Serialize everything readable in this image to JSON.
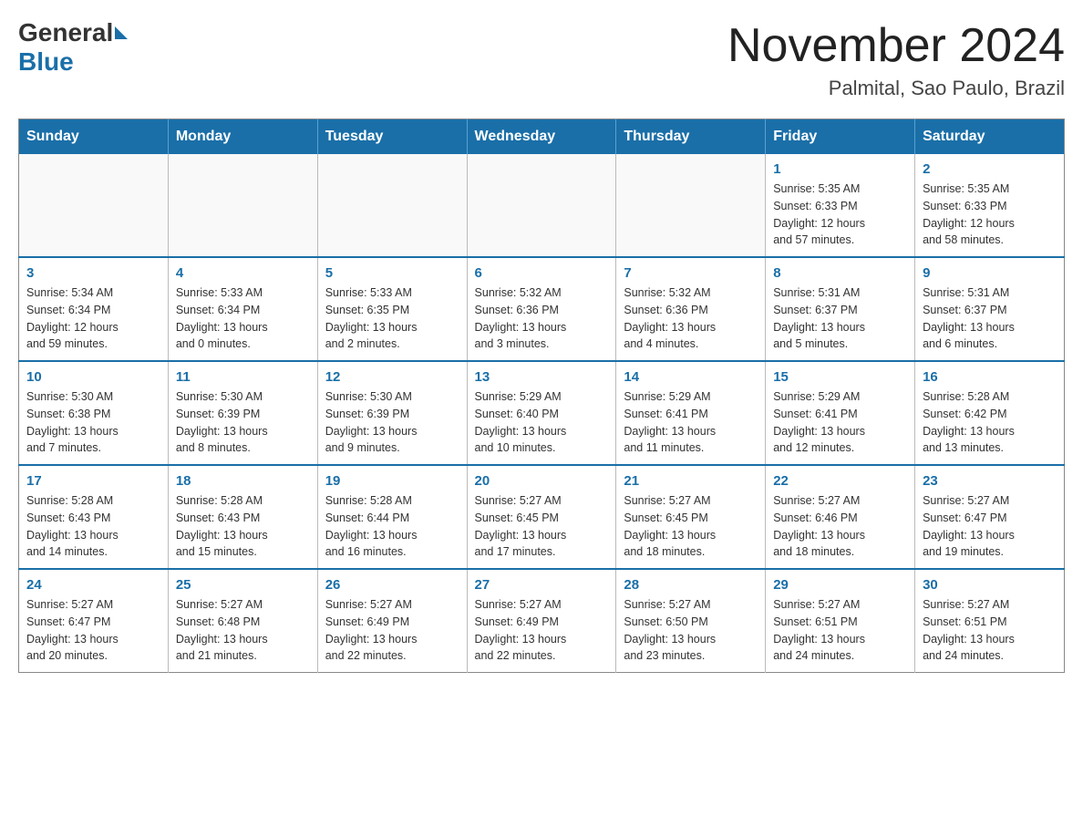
{
  "header": {
    "logo_general": "General",
    "logo_blue": "Blue",
    "month_title": "November 2024",
    "location": "Palmital, Sao Paulo, Brazil"
  },
  "days_of_week": [
    "Sunday",
    "Monday",
    "Tuesday",
    "Wednesday",
    "Thursday",
    "Friday",
    "Saturday"
  ],
  "weeks": [
    [
      {
        "day": "",
        "info": ""
      },
      {
        "day": "",
        "info": ""
      },
      {
        "day": "",
        "info": ""
      },
      {
        "day": "",
        "info": ""
      },
      {
        "day": "",
        "info": ""
      },
      {
        "day": "1",
        "info": "Sunrise: 5:35 AM\nSunset: 6:33 PM\nDaylight: 12 hours\nand 57 minutes."
      },
      {
        "day": "2",
        "info": "Sunrise: 5:35 AM\nSunset: 6:33 PM\nDaylight: 12 hours\nand 58 minutes."
      }
    ],
    [
      {
        "day": "3",
        "info": "Sunrise: 5:34 AM\nSunset: 6:34 PM\nDaylight: 12 hours\nand 59 minutes."
      },
      {
        "day": "4",
        "info": "Sunrise: 5:33 AM\nSunset: 6:34 PM\nDaylight: 13 hours\nand 0 minutes."
      },
      {
        "day": "5",
        "info": "Sunrise: 5:33 AM\nSunset: 6:35 PM\nDaylight: 13 hours\nand 2 minutes."
      },
      {
        "day": "6",
        "info": "Sunrise: 5:32 AM\nSunset: 6:36 PM\nDaylight: 13 hours\nand 3 minutes."
      },
      {
        "day": "7",
        "info": "Sunrise: 5:32 AM\nSunset: 6:36 PM\nDaylight: 13 hours\nand 4 minutes."
      },
      {
        "day": "8",
        "info": "Sunrise: 5:31 AM\nSunset: 6:37 PM\nDaylight: 13 hours\nand 5 minutes."
      },
      {
        "day": "9",
        "info": "Sunrise: 5:31 AM\nSunset: 6:37 PM\nDaylight: 13 hours\nand 6 minutes."
      }
    ],
    [
      {
        "day": "10",
        "info": "Sunrise: 5:30 AM\nSunset: 6:38 PM\nDaylight: 13 hours\nand 7 minutes."
      },
      {
        "day": "11",
        "info": "Sunrise: 5:30 AM\nSunset: 6:39 PM\nDaylight: 13 hours\nand 8 minutes."
      },
      {
        "day": "12",
        "info": "Sunrise: 5:30 AM\nSunset: 6:39 PM\nDaylight: 13 hours\nand 9 minutes."
      },
      {
        "day": "13",
        "info": "Sunrise: 5:29 AM\nSunset: 6:40 PM\nDaylight: 13 hours\nand 10 minutes."
      },
      {
        "day": "14",
        "info": "Sunrise: 5:29 AM\nSunset: 6:41 PM\nDaylight: 13 hours\nand 11 minutes."
      },
      {
        "day": "15",
        "info": "Sunrise: 5:29 AM\nSunset: 6:41 PM\nDaylight: 13 hours\nand 12 minutes."
      },
      {
        "day": "16",
        "info": "Sunrise: 5:28 AM\nSunset: 6:42 PM\nDaylight: 13 hours\nand 13 minutes."
      }
    ],
    [
      {
        "day": "17",
        "info": "Sunrise: 5:28 AM\nSunset: 6:43 PM\nDaylight: 13 hours\nand 14 minutes."
      },
      {
        "day": "18",
        "info": "Sunrise: 5:28 AM\nSunset: 6:43 PM\nDaylight: 13 hours\nand 15 minutes."
      },
      {
        "day": "19",
        "info": "Sunrise: 5:28 AM\nSunset: 6:44 PM\nDaylight: 13 hours\nand 16 minutes."
      },
      {
        "day": "20",
        "info": "Sunrise: 5:27 AM\nSunset: 6:45 PM\nDaylight: 13 hours\nand 17 minutes."
      },
      {
        "day": "21",
        "info": "Sunrise: 5:27 AM\nSunset: 6:45 PM\nDaylight: 13 hours\nand 18 minutes."
      },
      {
        "day": "22",
        "info": "Sunrise: 5:27 AM\nSunset: 6:46 PM\nDaylight: 13 hours\nand 18 minutes."
      },
      {
        "day": "23",
        "info": "Sunrise: 5:27 AM\nSunset: 6:47 PM\nDaylight: 13 hours\nand 19 minutes."
      }
    ],
    [
      {
        "day": "24",
        "info": "Sunrise: 5:27 AM\nSunset: 6:47 PM\nDaylight: 13 hours\nand 20 minutes."
      },
      {
        "day": "25",
        "info": "Sunrise: 5:27 AM\nSunset: 6:48 PM\nDaylight: 13 hours\nand 21 minutes."
      },
      {
        "day": "26",
        "info": "Sunrise: 5:27 AM\nSunset: 6:49 PM\nDaylight: 13 hours\nand 22 minutes."
      },
      {
        "day": "27",
        "info": "Sunrise: 5:27 AM\nSunset: 6:49 PM\nDaylight: 13 hours\nand 22 minutes."
      },
      {
        "day": "28",
        "info": "Sunrise: 5:27 AM\nSunset: 6:50 PM\nDaylight: 13 hours\nand 23 minutes."
      },
      {
        "day": "29",
        "info": "Sunrise: 5:27 AM\nSunset: 6:51 PM\nDaylight: 13 hours\nand 24 minutes."
      },
      {
        "day": "30",
        "info": "Sunrise: 5:27 AM\nSunset: 6:51 PM\nDaylight: 13 hours\nand 24 minutes."
      }
    ]
  ]
}
